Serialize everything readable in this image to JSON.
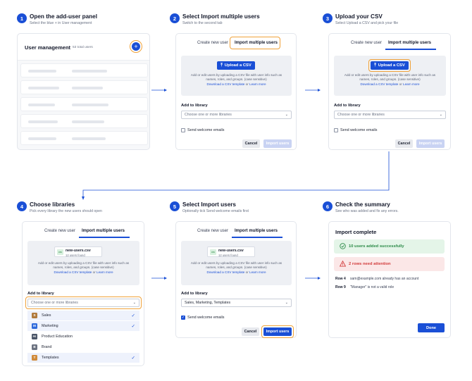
{
  "colors": {
    "accent": "#1a4fd6",
    "highlight": "#f0a23a",
    "success": "#2b8a47",
    "danger": "#d23c3c"
  },
  "steps": [
    {
      "num": "1",
      "title": "Open the add-user panel",
      "sub": "Select the blue + in User management"
    },
    {
      "num": "2",
      "title": "Select Import multiple users",
      "sub": "Switch to the second tab"
    },
    {
      "num": "3",
      "title": "Upload your CSV",
      "sub": "Select Upload a CSV and pick your file"
    },
    {
      "num": "4",
      "title": "Choose libraries",
      "sub": "Pick every library the new users should open"
    },
    {
      "num": "5",
      "title": "Select Import users",
      "sub": "Optionally tick Send welcome emails first"
    },
    {
      "num": "6",
      "title": "Check the summary",
      "sub": "See who was added and fix any errors."
    }
  ],
  "panel1": {
    "title": "User management",
    "count": "53 total users",
    "plus": "+"
  },
  "tabs": {
    "create": "Create new user",
    "import": "Import multiple users"
  },
  "dropzone": {
    "upload_label": "Upload a CSV",
    "help_line1": "Add or edit users by uploading a CSV file with user info such as",
    "help_line2": "names, roles, and groups. (case sensitive)",
    "link_template": "Download a CSV template",
    "or": "or",
    "link_learn": "Learn more"
  },
  "file": {
    "icon_label": "csv",
    "name": "new-users.csv",
    "meta": "12 users found"
  },
  "form": {
    "add_to_library": "Add to library",
    "placeholder": "Choose one or more libraries",
    "selected_value": "Sales, Marketing, Templates",
    "welcome": "Send welcome emails",
    "cancel": "Cancel",
    "import": "Import users",
    "checkmark": "✓"
  },
  "libraries": [
    {
      "initial": "S",
      "name": "Sales",
      "color": "#b07a3c",
      "checked": true
    },
    {
      "initial": "M",
      "name": "Marketing",
      "color": "#2f6bdc",
      "checked": true
    },
    {
      "initial": "PE",
      "name": "Product Education",
      "color": "#4a5568",
      "checked": false
    },
    {
      "initial": "B",
      "name": "Brand",
      "color": "#6b7280",
      "checked": false
    },
    {
      "initial": "T",
      "name": "Templates",
      "color": "#d08a3a",
      "checked": true
    }
  ],
  "summary": {
    "title": "Import complete",
    "success": "10 users added successfully",
    "warning": "2 rows need attention",
    "errors": [
      {
        "row": "Row 4",
        "msg": "sam@example.com already has an account"
      },
      {
        "row": "Row 9",
        "msg": "\"Manager\" is not a valid role"
      }
    ],
    "done": "Done"
  }
}
